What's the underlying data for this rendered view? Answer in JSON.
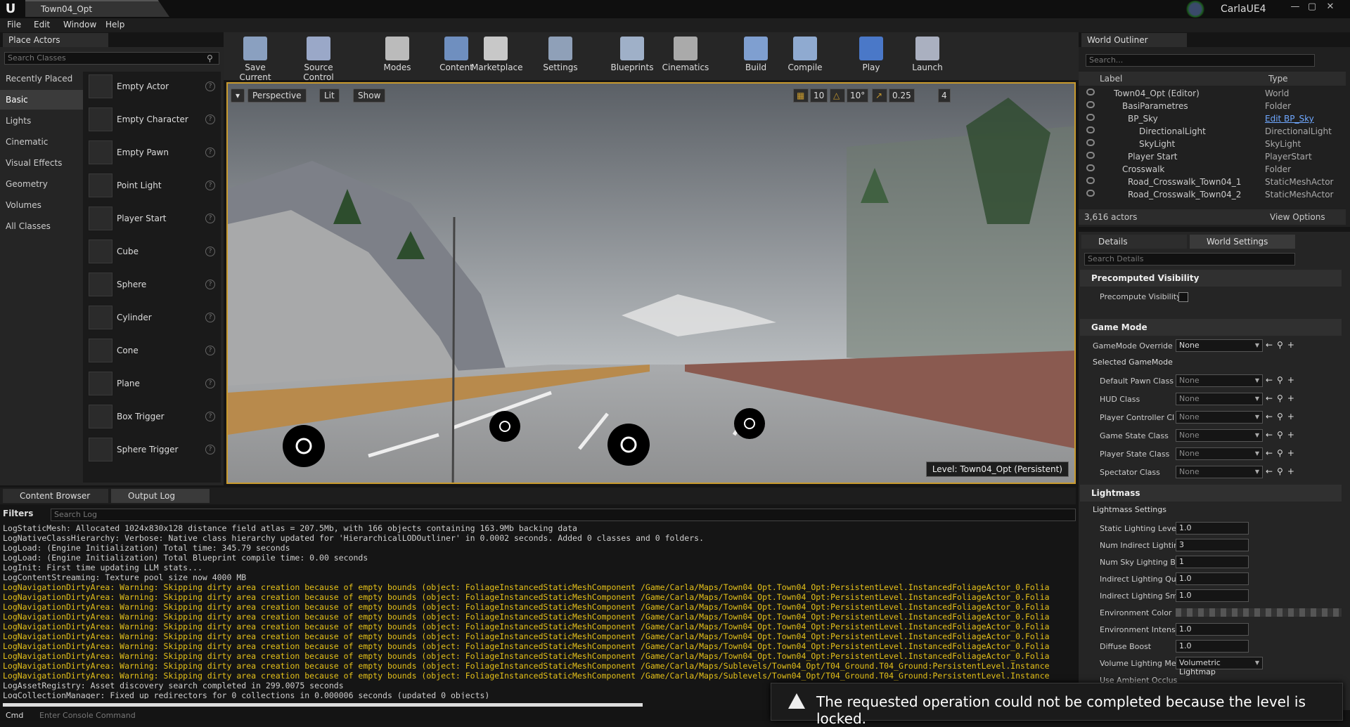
{
  "window": {
    "doc_tab": "Town04_Opt",
    "project": "CarlaUE4",
    "min": "—",
    "max": "▢",
    "close": "✕"
  },
  "menu": [
    "File",
    "Edit",
    "Window",
    "Help"
  ],
  "place_actors": {
    "tab": "Place Actors",
    "search_placeholder": "Search Classes",
    "categories": [
      "Recently Placed",
      "Basic",
      "Lights",
      "Cinematic",
      "Visual Effects",
      "Geometry",
      "Volumes",
      "All Classes"
    ],
    "selected_category": "Basic",
    "actors": [
      "Empty Actor",
      "Empty Character",
      "Empty Pawn",
      "Point Light",
      "Player Start",
      "Cube",
      "Sphere",
      "Cylinder",
      "Cone",
      "Plane",
      "Box Trigger",
      "Sphere Trigger"
    ]
  },
  "toolbar": [
    "Save Current",
    "Source Control",
    "Modes",
    "Content",
    "Marketplace",
    "Settings",
    "Blueprints",
    "Cinematics",
    "Build",
    "Compile",
    "Play",
    "Launch"
  ],
  "viewport": {
    "perspective": "Perspective",
    "lit": "Lit",
    "show": "Show",
    "grid_snap": "10",
    "rot_snap": "10°",
    "scale_snap": "0.25",
    "cam_speed": "4",
    "level": "Level:  Town04_Opt (Persistent)"
  },
  "outliner": {
    "tab": "World Outliner",
    "search_placeholder": "Search...",
    "col_label": "Label",
    "col_type": "Type",
    "rows": [
      {
        "label": "Town04_Opt (Editor)",
        "type": "World"
      },
      {
        "label": "BasiParametres",
        "type": "Folder"
      },
      {
        "label": "BP_Sky",
        "type": "Edit BP_Sky"
      },
      {
        "label": "DirectionalLight",
        "type": "DirectionalLight"
      },
      {
        "label": "SkyLight",
        "type": "SkyLight"
      },
      {
        "label": "Player Start",
        "type": "PlayerStart"
      },
      {
        "label": "Crosswalk",
        "type": "Folder"
      },
      {
        "label": "Road_Crosswalk_Town04_1",
        "type": "StaticMeshActor"
      },
      {
        "label": "Road_Crosswalk_Town04_2",
        "type": "StaticMeshActor"
      }
    ],
    "count": "3,616 actors",
    "view_options": "View Options"
  },
  "details": {
    "tab_details": "Details",
    "tab_world": "World Settings",
    "search_placeholder": "Search Details",
    "sec_precompute": "Precomputed Visibility",
    "precompute_label": "Precompute Visibility",
    "sec_gamemode": "Game Mode",
    "gamemode_override": "GameMode Override",
    "gamemode_value": "None",
    "selected_gamemode": "Selected GameMode",
    "gm_props": [
      {
        "label": "Default Pawn Class",
        "value": "None"
      },
      {
        "label": "HUD Class",
        "value": "None"
      },
      {
        "label": "Player Controller Cl",
        "value": "None"
      },
      {
        "label": "Game State Class",
        "value": "None"
      },
      {
        "label": "Player State Class",
        "value": "None"
      },
      {
        "label": "Spectator Class",
        "value": "None"
      }
    ],
    "sec_lightmass": "Lightmass",
    "lightmass_settings": "Lightmass Settings",
    "lm_props": [
      {
        "label": "Static Lighting Leve",
        "value": "1.0"
      },
      {
        "label": "Num Indirect Lightin",
        "value": "3"
      },
      {
        "label": "Num Sky Lighting Bo",
        "value": "1"
      },
      {
        "label": "Indirect Lighting Qu",
        "value": "1.0"
      },
      {
        "label": "Indirect Lighting Sm",
        "value": "1.0"
      }
    ],
    "env_color": "Environment Color",
    "lm_props2": [
      {
        "label": "Environment Intensi",
        "value": "1.0"
      },
      {
        "label": "Diffuse Boost",
        "value": "1.0"
      }
    ],
    "vol_label": "Volume Lighting Me",
    "vol_value": "Volumetric Lightmap",
    "use_ambient": "Use Ambient Occlus"
  },
  "bottom": {
    "tab_content": "Content Browser",
    "tab_log": "Output Log",
    "filters": "Filters",
    "log_search": "Search Log",
    "console_cmd": "Cmd",
    "console_placeholder": "Enter Console Command"
  },
  "log": [
    {
      "t": "n",
      "s": "LogStaticMesh: Allocated 1024x830x128 distance field atlas = 207.5Mb, with 166 objects containing 163.9Mb backing data"
    },
    {
      "t": "n",
      "s": "LogNativeClassHierarchy: Verbose: Native class hierarchy updated for 'HierarchicalLODOutliner' in 0.0002 seconds. Added 0 classes and 0 folders."
    },
    {
      "t": "n",
      "s": "LogLoad: (Engine Initialization) Total time: 345.79 seconds"
    },
    {
      "t": "n",
      "s": "LogLoad: (Engine Initialization) Total Blueprint compile time: 0.00 seconds"
    },
    {
      "t": "n",
      "s": "LogInit: First time updating LLM stats..."
    },
    {
      "t": "n",
      "s": "LogContentStreaming: Texture pool size now 4000 MB"
    },
    {
      "t": "w",
      "s": "LogNavigationDirtyArea: Warning: Skipping dirty area creation because of empty bounds (object: FoliageInstancedStaticMeshComponent /Game/Carla/Maps/Town04_Opt.Town04_Opt:PersistentLevel.InstancedFoliageActor_0.Folia"
    },
    {
      "t": "w",
      "s": "LogNavigationDirtyArea: Warning: Skipping dirty area creation because of empty bounds (object: FoliageInstancedStaticMeshComponent /Game/Carla/Maps/Town04_Opt.Town04_Opt:PersistentLevel.InstancedFoliageActor_0.Folia"
    },
    {
      "t": "w",
      "s": "LogNavigationDirtyArea: Warning: Skipping dirty area creation because of empty bounds (object: FoliageInstancedStaticMeshComponent /Game/Carla/Maps/Town04_Opt.Town04_Opt:PersistentLevel.InstancedFoliageActor_0.Folia"
    },
    {
      "t": "w",
      "s": "LogNavigationDirtyArea: Warning: Skipping dirty area creation because of empty bounds (object: FoliageInstancedStaticMeshComponent /Game/Carla/Maps/Town04_Opt.Town04_Opt:PersistentLevel.InstancedFoliageActor_0.Folia"
    },
    {
      "t": "w",
      "s": "LogNavigationDirtyArea: Warning: Skipping dirty area creation because of empty bounds (object: FoliageInstancedStaticMeshComponent /Game/Carla/Maps/Town04_Opt.Town04_Opt:PersistentLevel.InstancedFoliageActor_0.Folia"
    },
    {
      "t": "w",
      "s": "LogNavigationDirtyArea: Warning: Skipping dirty area creation because of empty bounds (object: FoliageInstancedStaticMeshComponent /Game/Carla/Maps/Town04_Opt.Town04_Opt:PersistentLevel.InstancedFoliageActor_0.Folia"
    },
    {
      "t": "w",
      "s": "LogNavigationDirtyArea: Warning: Skipping dirty area creation because of empty bounds (object: FoliageInstancedStaticMeshComponent /Game/Carla/Maps/Town04_Opt.Town04_Opt:PersistentLevel.InstancedFoliageActor_0.Folia"
    },
    {
      "t": "w",
      "s": "LogNavigationDirtyArea: Warning: Skipping dirty area creation because of empty bounds (object: FoliageInstancedStaticMeshComponent /Game/Carla/Maps/Town04_Opt.Town04_Opt:PersistentLevel.InstancedFoliageActor_0.Folia"
    },
    {
      "t": "w",
      "s": "LogNavigationDirtyArea: Warning: Skipping dirty area creation because of empty bounds (object: FoliageInstancedStaticMeshComponent /Game/Carla/Maps/Sublevels/Town04_Opt/T04_Ground.T04_Ground:PersistentLevel.Instance"
    },
    {
      "t": "w",
      "s": "LogNavigationDirtyArea: Warning: Skipping dirty area creation because of empty bounds (object: FoliageInstancedStaticMeshComponent /Game/Carla/Maps/Sublevels/Town04_Opt/T04_Ground.T04_Ground:PersistentLevel.Instance"
    },
    {
      "t": "n",
      "s": "LogAssetRegistry: Asset discovery search completed in 299.0075 seconds"
    },
    {
      "t": "n",
      "s": "LogCollectionManager: Fixed up redirectors for 0 collections in 0.000006 seconds (updated 0 objects)"
    }
  ],
  "toast": {
    "message": "The requested operation could not be completed because the level is locked."
  }
}
